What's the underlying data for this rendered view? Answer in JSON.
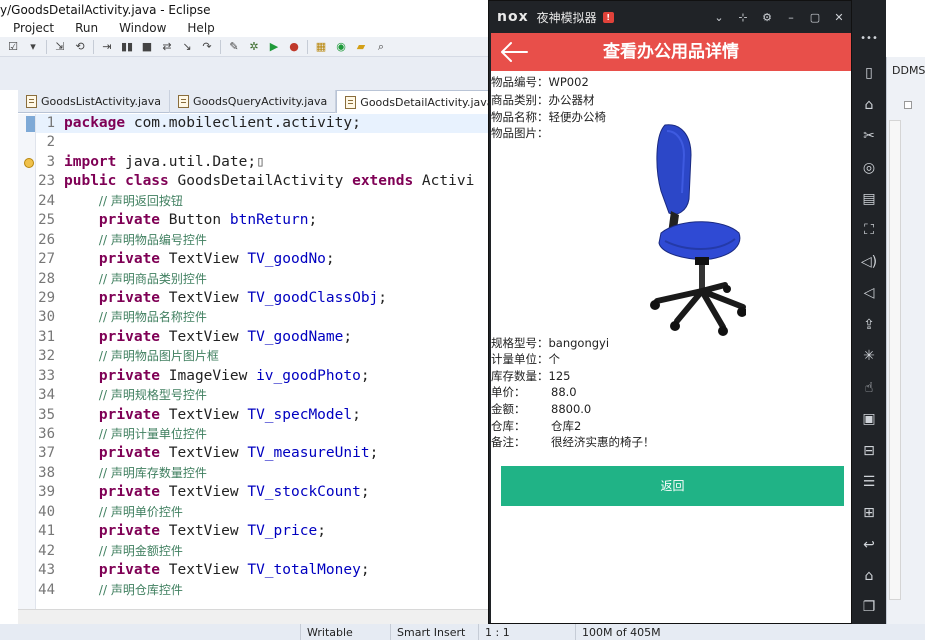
{
  "eclipse": {
    "title": "y/GoodsDetailActivity.java - Eclipse",
    "menu": [
      "Project",
      "Run",
      "Window",
      "Help"
    ],
    "tabs": [
      {
        "label": "GoodsListActivity.java",
        "active": false
      },
      {
        "label": "GoodsQueryActivity.java",
        "active": false
      },
      {
        "label": "GoodsDetailActivity.java",
        "active": true
      }
    ],
    "tab_close": "✕",
    "code_lines": [
      {
        "n": "1",
        "t": "pkg",
        "a": "package",
        "b": " com.mobileclient.activity;"
      },
      {
        "n": "2",
        "t": "blank"
      },
      {
        "n": "3",
        "t": "imp",
        "a": "import",
        "b": " java.util.Date;"
      },
      {
        "n": "23",
        "t": "cls",
        "a": "public class",
        "b": " GoodsDetailActivity ",
        "c": "extends",
        "d": " Activi"
      },
      {
        "n": "24",
        "t": "cm",
        "a": "// 声明返回按钮"
      },
      {
        "n": "25",
        "t": "fld",
        "a": "private",
        "b": " Button ",
        "c": "btnReturn",
        "d": ";"
      },
      {
        "n": "26",
        "t": "cm",
        "a": "// 声明物品编号控件"
      },
      {
        "n": "27",
        "t": "fld",
        "a": "private",
        "b": " TextView ",
        "c": "TV_goodNo",
        "d": ";"
      },
      {
        "n": "28",
        "t": "cm",
        "a": "// 声明商品类别控件"
      },
      {
        "n": "29",
        "t": "fld",
        "a": "private",
        "b": " TextView ",
        "c": "TV_goodClassObj",
        "d": ";"
      },
      {
        "n": "30",
        "t": "cm",
        "a": "// 声明物品名称控件"
      },
      {
        "n": "31",
        "t": "fld",
        "a": "private",
        "b": " TextView ",
        "c": "TV_goodName",
        "d": ";"
      },
      {
        "n": "32",
        "t": "cm",
        "a": "// 声明物品图片图片框"
      },
      {
        "n": "33",
        "t": "fld",
        "a": "private",
        "b": " ImageView ",
        "c": "iv_goodPhoto",
        "d": ";"
      },
      {
        "n": "34",
        "t": "cm",
        "a": "// 声明规格型号控件"
      },
      {
        "n": "35",
        "t": "fld",
        "a": "private",
        "b": " TextView ",
        "c": "TV_specModel",
        "d": ";"
      },
      {
        "n": "36",
        "t": "cm",
        "a": "// 声明计量单位控件"
      },
      {
        "n": "37",
        "t": "fld",
        "a": "private",
        "b": " TextView ",
        "c": "TV_measureUnit",
        "d": ";"
      },
      {
        "n": "38",
        "t": "cm",
        "a": "// 声明库存数量控件"
      },
      {
        "n": "39",
        "t": "fld",
        "a": "private",
        "b": " TextView ",
        "c": "TV_stockCount",
        "d": ";"
      },
      {
        "n": "40",
        "t": "cm",
        "a": "// 声明单价控件"
      },
      {
        "n": "41",
        "t": "fld",
        "a": "private",
        "b": " TextView ",
        "c": "TV_price",
        "d": ";"
      },
      {
        "n": "42",
        "t": "cm",
        "a": "// 声明金额控件"
      },
      {
        "n": "43",
        "t": "fld",
        "a": "private",
        "b": " TextView ",
        "c": "TV_totalMoney",
        "d": ";"
      },
      {
        "n": "44",
        "t": "cm",
        "a": "// 声明仓库控件"
      }
    ],
    "status": {
      "writable": "Writable",
      "insert": "Smart Insert",
      "pos": "1 : 1",
      "memory": "100M of 405M"
    }
  },
  "nox": {
    "logo": "nox",
    "name": "夜神模拟器",
    "badge": "!",
    "controls": [
      "⌄",
      "⊹",
      "⚙",
      "–",
      "▢",
      "✕"
    ]
  },
  "app": {
    "title": "查看办公用品详情",
    "fields_top": [
      {
        "label": "物品编号：",
        "value": "WP002"
      },
      {
        "label": "商品类别：",
        "value": "办公器材"
      },
      {
        "label": "物品名称：",
        "value": "轻便办公椅"
      },
      {
        "label": "物品图片：",
        "value": ""
      }
    ],
    "fields_bottom": [
      {
        "label": "规格型号：",
        "value": "bangongyi"
      },
      {
        "label": "计量单位：",
        "value": "个"
      },
      {
        "label": "库存数量：",
        "value": "125"
      },
      {
        "label": "单价：",
        "value": "88.0"
      },
      {
        "label": "金额：",
        "value": "8800.0"
      },
      {
        "label": "仓库：",
        "value": "仓库2"
      },
      {
        "label": "备注：",
        "value": "很经济实惠的椅子！"
      }
    ],
    "return_label": "返回"
  },
  "side": {
    "ddms": "DDMS",
    "more": "•••"
  },
  "colors": {
    "app_bar": "#e84f4a",
    "return_button": "#20b386",
    "emulator_frame": "#202327"
  }
}
